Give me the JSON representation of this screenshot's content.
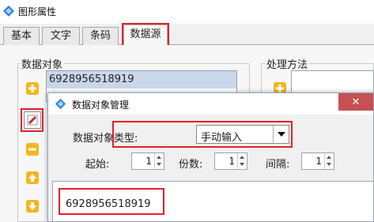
{
  "window": {
    "title": "图形属性",
    "icon": "app-diamond-icon"
  },
  "tabs": [
    {
      "label": "基本"
    },
    {
      "label": "文字"
    },
    {
      "label": "条码"
    },
    {
      "label": "数据源"
    }
  ],
  "data_objects": {
    "group_label": "数据对象",
    "items": [
      "6928956518919"
    ],
    "buttons": [
      "add-icon",
      "edit-icon",
      "remove-icon",
      "move-up-icon",
      "move-down-icon"
    ]
  },
  "processing": {
    "group_label": "处理方法",
    "buttons": [
      "add-icon"
    ]
  },
  "dialog": {
    "title": "数据对象管理",
    "type_label": "数据对象类型:",
    "type_value": "手动输入",
    "start_label": "起始:",
    "start_value": "1",
    "digits_label": "份数:",
    "digits_value": "1",
    "interval_label": "间隔:",
    "interval_value": "1",
    "content": "6928956518919",
    "close_label": "✕"
  },
  "colors": {
    "highlight": "#e3202a",
    "selection": "#c8d8ea",
    "close": "#c75050"
  }
}
